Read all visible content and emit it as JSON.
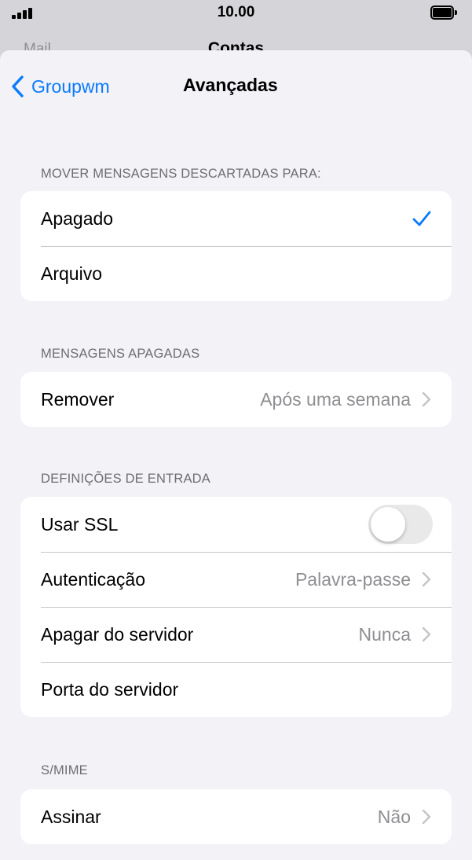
{
  "status_bar": {
    "time": "10.00"
  },
  "behind": {
    "back_label": "Mail",
    "title": "Contas"
  },
  "nav": {
    "back_label": "Groupwm",
    "title": "Avançadas"
  },
  "sections": {
    "move": {
      "header": "MOVER MENSAGENS DESCARTADAS PARA:",
      "rows": [
        {
          "label": "Apagado",
          "selected": true
        },
        {
          "label": "Arquivo",
          "selected": false
        }
      ]
    },
    "deleted": {
      "header": "MENSAGENS APAGADAS",
      "rows": [
        {
          "label": "Remover",
          "value": "Após uma semana"
        }
      ]
    },
    "incoming": {
      "header": "DEFINIÇÕES DE ENTRADA",
      "rows": [
        {
          "label": "Usar SSL",
          "toggle": false
        },
        {
          "label": "Autenticação",
          "value": "Palavra-passe"
        },
        {
          "label": "Apagar do servidor",
          "value": "Nunca"
        },
        {
          "label": "Porta do servidor"
        }
      ]
    },
    "smime": {
      "header": "S/MIME",
      "rows": [
        {
          "label": "Assinar",
          "value": "Não"
        }
      ]
    }
  },
  "colors": {
    "accent": "#0a7aff",
    "background": "#f2f2f7",
    "secondary_text": "#8e8e93"
  }
}
